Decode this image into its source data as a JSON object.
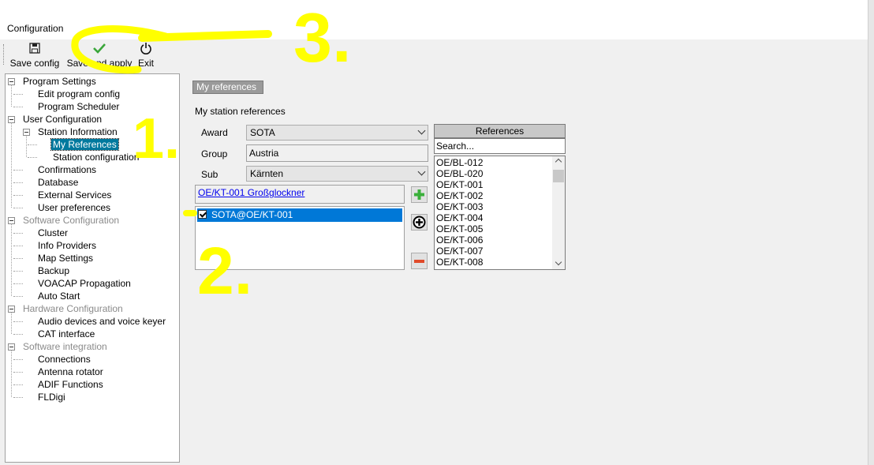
{
  "window": {
    "title": "Configuration"
  },
  "toolbar": {
    "save_config": "Save config",
    "save_apply": "Save and apply",
    "exit": "Exit"
  },
  "tree": [
    {
      "label": "Program Settings",
      "level": 0,
      "expanded": true,
      "grey": false
    },
    {
      "label": "Edit program config",
      "level": 1
    },
    {
      "label": "Program Scheduler",
      "level": 1
    },
    {
      "label": "User Configuration",
      "level": 0,
      "expanded": true,
      "grey": false
    },
    {
      "label": "Station Information",
      "level": 1,
      "expanded": true
    },
    {
      "label": "My References",
      "level": 2,
      "selected": true
    },
    {
      "label": "Station configuration",
      "level": 2
    },
    {
      "label": "Confirmations",
      "level": 1
    },
    {
      "label": "Database",
      "level": 1
    },
    {
      "label": "External Services",
      "level": 1
    },
    {
      "label": "User preferences",
      "level": 1
    },
    {
      "label": "Software Configuration",
      "level": 0,
      "expanded": true,
      "grey": true
    },
    {
      "label": "Cluster",
      "level": 1
    },
    {
      "label": "Info Providers",
      "level": 1
    },
    {
      "label": "Map Settings",
      "level": 1
    },
    {
      "label": "Backup",
      "level": 1
    },
    {
      "label": "VOACAP Propagation",
      "level": 1
    },
    {
      "label": "Auto Start",
      "level": 1
    },
    {
      "label": "Hardware Configuration",
      "level": 0,
      "expanded": true,
      "grey": true
    },
    {
      "label": "Audio devices and voice keyer",
      "level": 1
    },
    {
      "label": "CAT interface",
      "level": 1
    },
    {
      "label": "Software integration",
      "level": 0,
      "expanded": true,
      "grey": true
    },
    {
      "label": "Connections",
      "level": 1
    },
    {
      "label": "Antenna rotator",
      "level": 1
    },
    {
      "label": "ADIF Functions",
      "level": 1
    },
    {
      "label": "FLDigi",
      "level": 1
    }
  ],
  "main": {
    "header": "My references",
    "section_title": "My station references",
    "award_label": "Award",
    "award_value": "SOTA",
    "group_label": "Group",
    "group_value": "Austria",
    "sub_label": "Sub",
    "sub_value": "Kärnten",
    "selected_ref_link": "OE/KT-001 Großglockner",
    "my_refs": [
      {
        "label": "SOTA@OE/KT-001",
        "checked": true
      }
    ]
  },
  "references": {
    "header": "References",
    "search_placeholder": "Search...",
    "items": [
      "OE/BL-012",
      "OE/BL-020",
      "OE/KT-001",
      "OE/KT-002",
      "OE/KT-003",
      "OE/KT-004",
      "OE/KT-005",
      "OE/KT-006",
      "OE/KT-007",
      "OE/KT-008"
    ]
  },
  "annotations": {
    "mark1": "1.",
    "mark2": "2.",
    "mark3": "3."
  },
  "colors": {
    "highlight": "#00799e",
    "selection": "#0078d7",
    "annotation": "#ffff00"
  }
}
